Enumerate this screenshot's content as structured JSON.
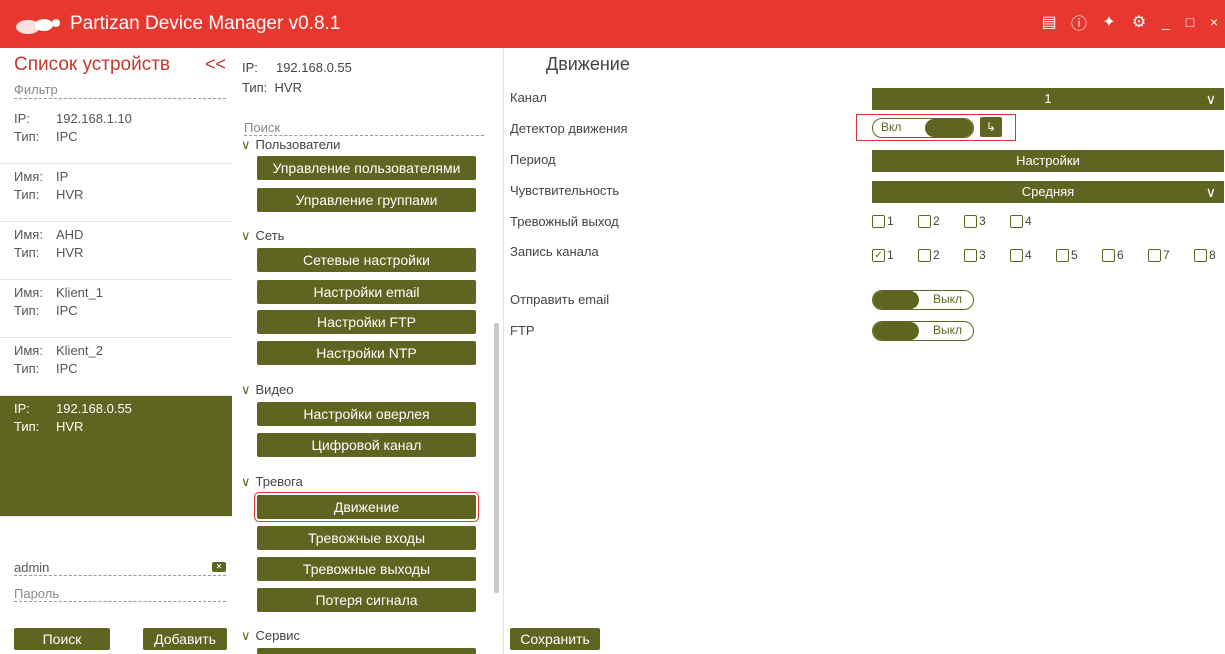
{
  "app": {
    "title": "Partizan Device Manager v0.8.1"
  },
  "titlebar_icons": [
    "book-icon",
    "help-icon",
    "wand-icon",
    "gear-icon",
    "minimize-icon",
    "maximize-icon",
    "close-icon"
  ],
  "devices_panel": {
    "heading": "Список устройств",
    "collapse_label": "<<",
    "filter_placeholder": "Фильтр",
    "devices": [
      {
        "k1": "IP:",
        "v1": "192.168.1.10",
        "k2": "Тип:",
        "v2": "IPC"
      },
      {
        "k1": "Имя:",
        "v1": "IP",
        "k2": "Тип:",
        "v2": "HVR"
      },
      {
        "k1": "Имя:",
        "v1": "AHD",
        "k2": "Тип:",
        "v2": "HVR"
      },
      {
        "k1": "Имя:",
        "v1": "Klient_1",
        "k2": "Тип:",
        "v2": "IPC"
      },
      {
        "k1": "Имя:",
        "v1": "Klient_2",
        "k2": "Тип:",
        "v2": "IPC"
      },
      {
        "k1": "IP:",
        "v1": "192.168.0.55",
        "k2": "Тип:",
        "v2": "HVR",
        "selected": true
      }
    ],
    "username": "admin",
    "password_placeholder": "Пароль",
    "search_button": "Поиск",
    "add_button": "Добавить"
  },
  "settings_panel": {
    "ip_key": "IP:",
    "ip_value": "192.168.0.55",
    "type_key": "Тип:",
    "type_value": "HVR",
    "search_placeholder": "Поиск",
    "groups": {
      "users": "Пользователи",
      "network": "Сеть",
      "video": "Видео",
      "alarm": "Тревога",
      "service": "Сервис"
    },
    "buttons": {
      "user_mgmt": "Управление пользователями",
      "group_mgmt": "Управление группами",
      "net_settings": "Сетевые настройки",
      "email_settings": "Настройки email",
      "ftp_settings": "Настройки FTP",
      "ntp_settings": "Настройки NTP",
      "overlay_settings": "Настройки оверлея",
      "digital_channel": "Цифровой канал",
      "motion": "Движение",
      "alarm_inputs": "Тревожные входы",
      "alarm_outputs": "Тревожные выходы",
      "signal_loss": "Потеря сигнала"
    }
  },
  "motion_panel": {
    "title": "Движение",
    "labels": {
      "channel": "Канал",
      "motion_detector": "Детектор движения",
      "period": "Период",
      "sensitivity": "Чувствительность",
      "alarm_output": "Тревожный выход",
      "channel_record": "Запись канала",
      "send_email": "Отправить email",
      "ftp": "FTP"
    },
    "channel_value": "1",
    "detector_toggle": "Вкл",
    "period_button": "Настройки",
    "sensitivity_value": "Средняя",
    "alarm_outputs": [
      {
        "label": "1",
        "checked": false
      },
      {
        "label": "2",
        "checked": false
      },
      {
        "label": "3",
        "checked": false
      },
      {
        "label": "4",
        "checked": false
      }
    ],
    "record_channels": [
      {
        "label": "1",
        "checked": true
      },
      {
        "label": "2",
        "checked": false
      },
      {
        "label": "3",
        "checked": false
      },
      {
        "label": "4",
        "checked": false
      },
      {
        "label": "5",
        "checked": false
      },
      {
        "label": "6",
        "checked": false
      },
      {
        "label": "7",
        "checked": false
      },
      {
        "label": "8",
        "checked": false
      }
    ],
    "email_toggle": "Выкл",
    "ftp_toggle": "Выкл",
    "save_button": "Сохранить"
  }
}
